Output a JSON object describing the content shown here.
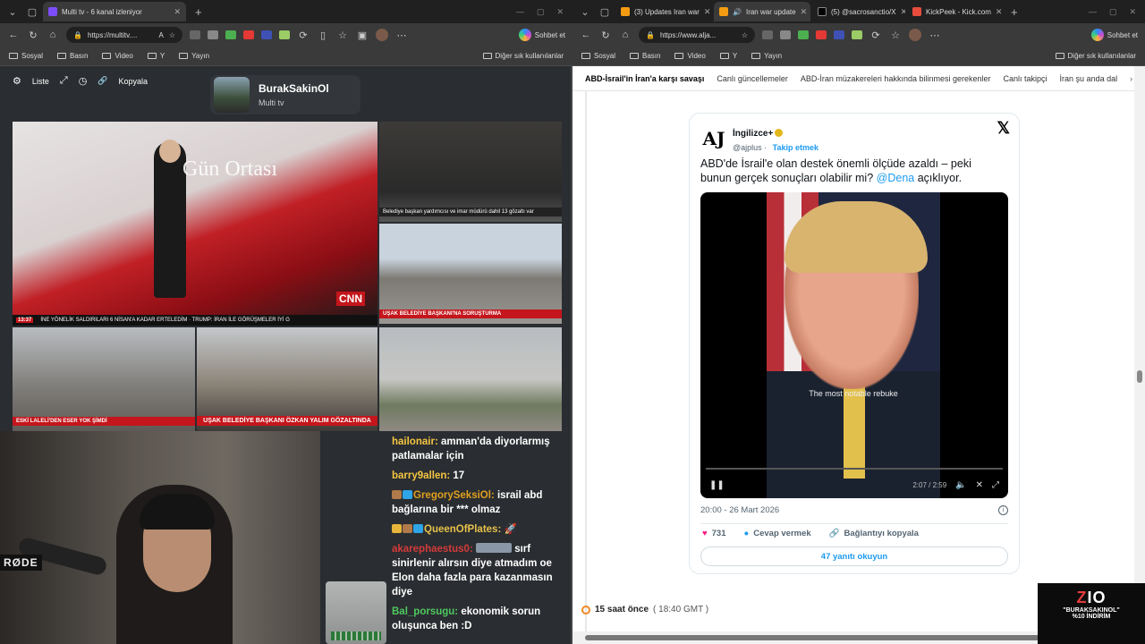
{
  "left": {
    "tabs": [
      {
        "label": "Multi tv - 6 kanal izleniyor",
        "color": "#7c4dff"
      }
    ],
    "url": "https://multitv....",
    "chat_btn": "Sohbet et",
    "bookmarks": [
      "Sosyal",
      "Basın",
      "Video",
      "Y",
      "Yayın"
    ],
    "bookmarks_other": "Diğer sık kullanılanlar",
    "toolbar": {
      "list": "Liste",
      "copy": "Kopyala"
    },
    "channel": {
      "name": "BurakSakinOl",
      "sub": "Multi tv"
    },
    "tiles": {
      "main_logo": "Gün Ortası",
      "cnn": "CNN",
      "main_ticker_time": "13:37",
      "main_ticker": "İNE YÖNELİK SALDIRILARI 6 NİSAN'A KADAR ERTELEDİM · TRUMP: İRAN İLE GÖRÜŞMELER İYİ G",
      "t2_lower": "Belediye başkan yardımcısı ve imar müdürü dahil 13 gözaltı var",
      "t3_lower": "UŞAK BELEDİYE BAŞKANI'NA SORUŞTURMA",
      "t4_lower": "ESKİ LALELİ'DEN ESER YOK ŞİMDİ",
      "t5_lower": "UŞAK BELEDİYE BAŞKANI ÖZKAN YALIM GÖZALTINDA"
    },
    "webcam_brand": "RØDE",
    "chat": [
      {
        "user": "hailonair",
        "color": "#f5c542",
        "text": "amman'da diyorlarmış patlamalar için"
      },
      {
        "user": "barry9allen",
        "color": "#f5c542",
        "text": "17"
      },
      {
        "user": "GregorySeksiOl",
        "color": "#e0a020",
        "text": "israil abd bağlarına bir *** olmaz"
      },
      {
        "user": "QueenOfPlates",
        "color": "#e6c14b",
        "text": "🚀"
      },
      {
        "user": "akarephaestus0",
        "color": "#d43a3a",
        "text": "sırf sinirlenir alırsın diye atmadım oe Elon daha fazla para kazanmasın diye"
      },
      {
        "user": "Bal_porsugu",
        "color": "#4fc95f",
        "text": "ekonomik sorun oluşunca ben :D"
      }
    ]
  },
  "right": {
    "tabs": [
      {
        "label": "(3) Updates Iran war",
        "color": "#f39c12"
      },
      {
        "label": "Iran war update",
        "color": "#f39c12"
      },
      {
        "label": "(5) @sacrosanctio/X",
        "color": "#000000"
      },
      {
        "label": "KickPeek - Kick.com",
        "color": "#e74c3c"
      }
    ],
    "url": "https://www.alja...",
    "chat_btn": "Sohbet et",
    "bookmarks": [
      "Sosyal",
      "Basın",
      "Video",
      "Y",
      "Yayın"
    ],
    "bookmarks_other": "Diğer sık kullanılanlar",
    "subnav": [
      "ABD-İsrail'in İran'a karşı savaşı",
      "Canlı güncellemeler",
      "ABD-İran müzakereleri hakkında bilinmesi gerekenler",
      "Canlı takipçi",
      "İran şu anda dal"
    ],
    "tweet": {
      "name": "İngilizce+",
      "handle": "@ajplus",
      "follow": "Takip etmek",
      "text": "ABD'de İsrail'e olan destek önemli ölçüde azaldı – peki bunun gerçek sonuçları olabilir mi?",
      "mention": "@Dena",
      "text_tail": "açıklıyor.",
      "caption": "The most notable rebuke",
      "time": "2:07 / 2:59",
      "date": "20:00 - 26 Mart 2026",
      "likes": "731",
      "reply": "Cevap vermek",
      "copy_link": "Bağlantıyı kopyala",
      "more": "47 yanıtı okuyun"
    },
    "timeline": {
      "ago": "15 saat önce",
      "gmt": "( 18:40 GMT )"
    }
  },
  "promo": {
    "logo_a": "Z",
    "logo_b": "IO",
    "line1": "\"BURAKSAKINOL\"",
    "line2": "%10 İNDİRİM"
  }
}
